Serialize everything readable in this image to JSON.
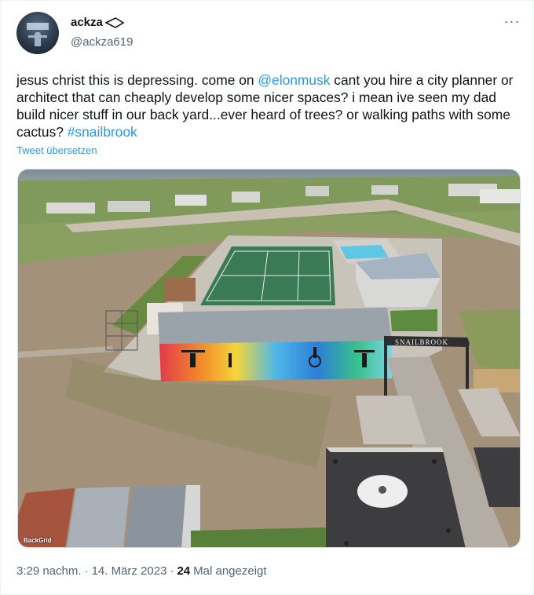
{
  "user": {
    "display_name": "ackza",
    "handle": "@ackza619",
    "avatar_icon": "avatar-image",
    "name_emoji_icon": "arrowhead-emoji"
  },
  "menu": {
    "more_icon": "more-horizontal-icon",
    "glyph": "···"
  },
  "tweet": {
    "text_part1": "jesus christ this is depressing. come on ",
    "mention": "@elonmusk",
    "text_part2": " cant you hire a city planner or architect that can cheaply develop some nicer spaces? i mean ive seen my dad build nicer stuff in our back yard...ever heard of trees? or walking paths with some cactus? ",
    "hashtag": "#snailbrook",
    "translate_label": "Tweet übersetzen"
  },
  "media": {
    "description_icon": "aerial-photo",
    "credit": "BackGrid",
    "sign_text": "SNAILBROOK"
  },
  "meta": {
    "time": "3:29 nachm.",
    "sep1": "·",
    "date": "14. März 2023",
    "sep2": "·",
    "views": "24",
    "views_label": "Mal angezeigt"
  },
  "colors": {
    "link": "#1d9bf0",
    "text": "#0f1419",
    "secondary": "#536471"
  }
}
